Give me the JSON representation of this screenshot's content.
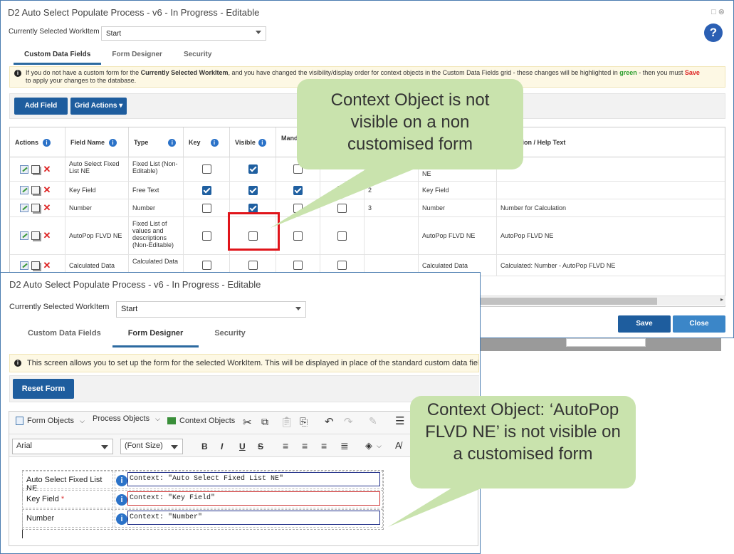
{
  "dialog1": {
    "title": "D2 Auto Select Populate Process - v6 - In Progress - Editable",
    "window_icons": "□ ⊗",
    "workitem_label": "Currently Selected WorkItem",
    "workitem_value": "Start",
    "help_icon": "?",
    "tabs": [
      "Custom Data Fields",
      "Form Designer",
      "Security"
    ],
    "active_tab": "Custom Data Fields",
    "banner": {
      "pre": "If you do not have a custom form for the ",
      "bold": "Currently Selected WorkItem",
      "mid": ", and you have changed the visibility/display order for context objects in the Custom Data Fields grid - these changes will be highlighted in ",
      "green": "green",
      "post": " - then you must ",
      "red": "Save",
      "line2": "to apply your changes to the database."
    },
    "buttons": {
      "add_field": "Add Field",
      "grid_actions": "Grid Actions ▾",
      "save": "Save",
      "close": "Close"
    },
    "columns": [
      "Actions",
      "Field Name",
      "Type",
      "Key",
      "Visible",
      "Mand",
      "",
      "",
      "ption / Help Text"
    ],
    "rows": [
      {
        "name": "Auto Select Fixed List NE",
        "type": "Fixed List (Non-Editable)",
        "key": false,
        "visible": true,
        "mand": false,
        "order": "",
        "field": "NE",
        "help": ""
      },
      {
        "name": "Key Field",
        "type": "Free Text",
        "key": true,
        "visible": true,
        "mand": true,
        "order": "2",
        "field": "Key Field",
        "help": ""
      },
      {
        "name": "Number",
        "type": "Number",
        "key": false,
        "visible": true,
        "mand": false,
        "order": "3",
        "field": "Number",
        "help": "Number for Calculation"
      },
      {
        "name": "AutoPop FLVD NE",
        "type": "Fixed List of values and descriptions (Non-Editable)",
        "key": false,
        "visible": false,
        "mand": false,
        "order": "",
        "field": "AutoPop FLVD NE",
        "help": "AutoPop FLVD NE"
      },
      {
        "name": "Calculated Data",
        "type": "Calculated Data",
        "key": false,
        "visible": false,
        "mand": false,
        "order": "",
        "field": "Calculated Data",
        "help": "Calculated: Number - AutoPop FLVD NE"
      }
    ]
  },
  "dialog2": {
    "title": "D2 Auto Select Populate Process - v6 - In Progress - Editable",
    "workitem_label": "Currently Selected WorkItem",
    "workitem_value": "Start",
    "tabs": [
      "Custom Data Fields",
      "Form Designer",
      "Security"
    ],
    "active_tab": "Form Designer",
    "banner": "This screen allows you to set up the form for the selected WorkItem. This will be displayed in place of the standard custom data fields v",
    "reset_button": "Reset Form",
    "toolbar": {
      "form_objects": "Form Objects",
      "process_objects": "Process Objects",
      "context_objects": "Context Objects",
      "font": "Arial",
      "font_size": "(Font Size)",
      "bold": "B",
      "italic": "I",
      "underline": "U",
      "strike": "S"
    },
    "form_rows": [
      {
        "label": "Auto Select Fixed List NE",
        "value": "Context: \"Auto Select Fixed List NE\"",
        "required": false
      },
      {
        "label": "Key Field",
        "value": "Context: \"Key Field\"",
        "required": true
      },
      {
        "label": "Number",
        "value": "Context: \"Number\"",
        "required": false
      }
    ]
  },
  "callouts": {
    "top": "Context Object is not visible on a non customised form",
    "bottom": "Context Object: ‘AutoPop FLVD NE’ is not visible on a customised form"
  },
  "colors": {
    "accent": "#1e5d9e",
    "callout": "#c9e3ad",
    "highlight_red": "#e0141a",
    "banner_green": "#2e9e2e"
  }
}
